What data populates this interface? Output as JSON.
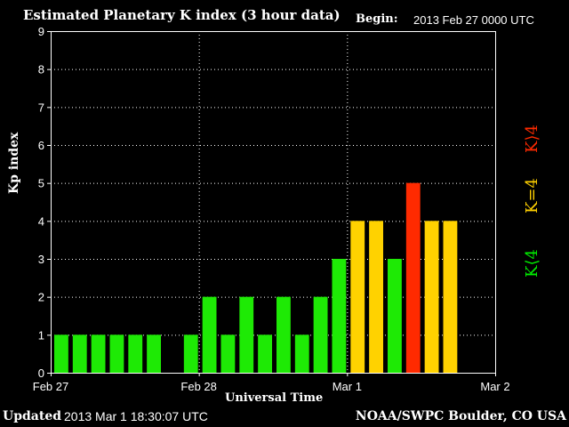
{
  "header": {
    "title": "Estimated Planetary K index (3 hour data)",
    "begin_label": "Begin:",
    "begin_value": "2013 Feb 27 0000 UTC"
  },
  "footer": {
    "updated_label": "Updated",
    "updated_value": "2013 Mar  1 18:30:07 UTC",
    "source": "NOAA/SWPC Boulder, CO USA"
  },
  "legend": {
    "low": "K⟨4",
    "equal": "K=4",
    "high": "K⟩4"
  },
  "colors": {
    "low": "#1eea05",
    "equal": "#ffd200",
    "high": "#ff2a00",
    "axis": "#ffffff",
    "background": "#000000"
  },
  "chart_data": {
    "type": "bar",
    "title": "Estimated Planetary K index (3 hour data)",
    "xlabel": "Universal Time",
    "ylabel": "Kp index",
    "ylim": [
      0,
      9
    ],
    "yticks": [
      "0",
      "1",
      "2",
      "3",
      "4",
      "5",
      "6",
      "7",
      "8",
      "9"
    ],
    "x_tick_labels": [
      "Feb 27",
      "Feb 28",
      "Mar 1",
      "Mar 2"
    ],
    "grid": true,
    "bar_interval_hours": 3,
    "values": [
      1,
      1,
      1,
      1,
      1,
      1,
      0,
      1,
      2,
      1,
      2,
      1,
      2,
      1,
      2,
      3,
      4,
      4,
      3,
      5,
      4,
      4
    ]
  }
}
